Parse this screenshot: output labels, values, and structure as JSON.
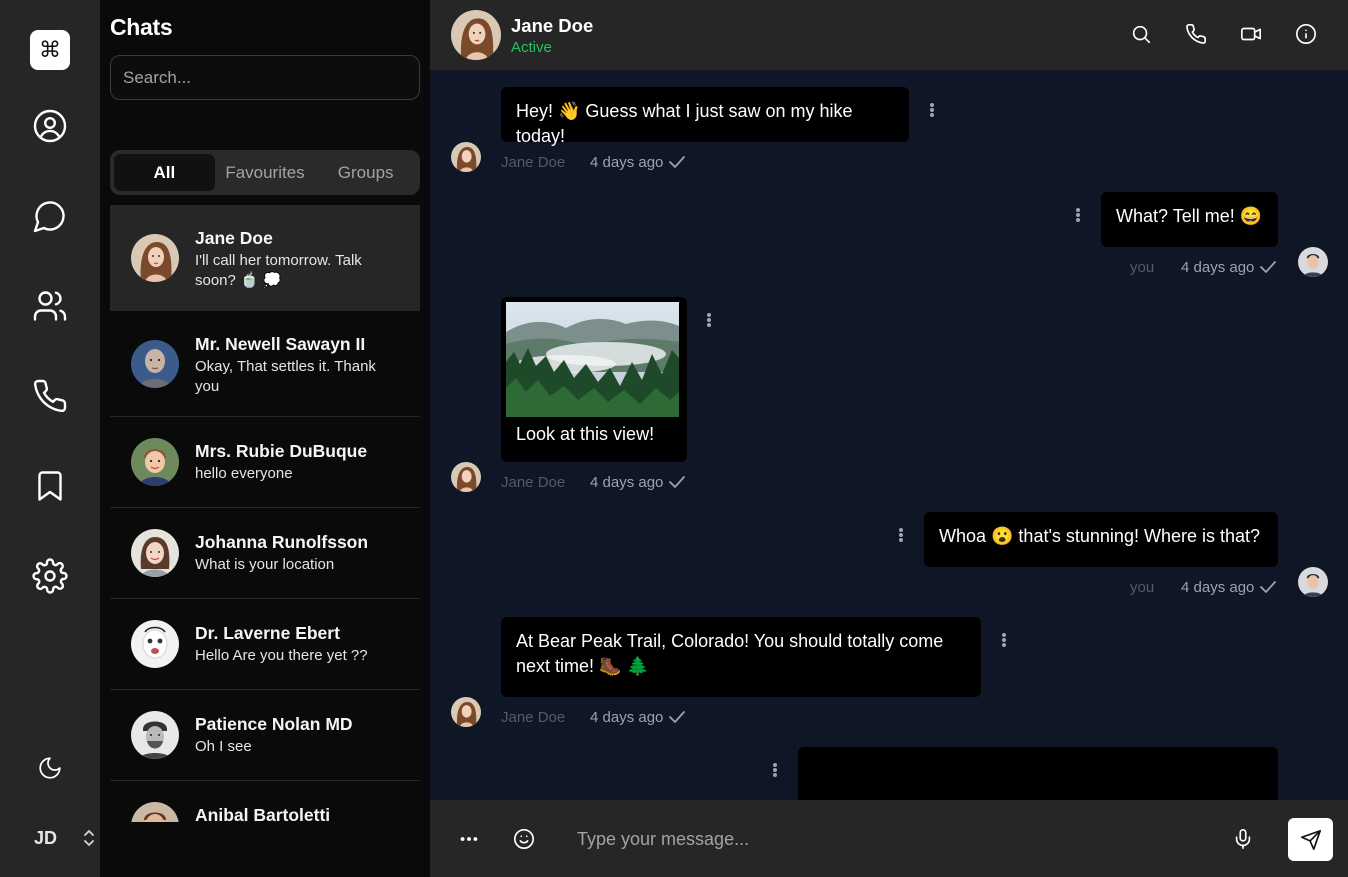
{
  "rail": {
    "logo_glyph": "⌘",
    "icons": [
      "user-circle-icon",
      "chat-bubble-icon",
      "users-icon",
      "phone-icon",
      "bookmark-icon",
      "gear-icon",
      "moon-icon"
    ],
    "user_initials": "JD"
  },
  "sidebar": {
    "title": "Chats",
    "search_placeholder": "Search...",
    "tabs": [
      {
        "label": "All",
        "active": true
      },
      {
        "label": "Favourites",
        "active": false
      },
      {
        "label": "Groups",
        "active": false
      }
    ],
    "chats": [
      {
        "name": "Jane Doe",
        "last_message": "I'll call her tomorrow. Talk soon? 🍵 💭",
        "active": true
      },
      {
        "name": "Mr. Newell Sawayn II",
        "last_message": "Okay, That settles it. Thank you",
        "active": false
      },
      {
        "name": "Mrs. Rubie DuBuque",
        "last_message": "hello everyone",
        "active": false
      },
      {
        "name": "Johanna Runolfsson",
        "last_message": "What is your location",
        "active": false
      },
      {
        "name": "Dr. Laverne Ebert",
        "last_message": "Hello Are you there yet ??",
        "active": false
      },
      {
        "name": "Patience Nolan MD",
        "last_message": "Oh I see",
        "active": false
      },
      {
        "name": "Anibal Bartoletti",
        "last_message": "",
        "active": false
      }
    ]
  },
  "header": {
    "name": "Jane Doe",
    "status": "Active",
    "status_color": "#22c55e",
    "actions": [
      "search-icon",
      "phone-icon",
      "video-icon",
      "info-icon"
    ]
  },
  "messages": [
    {
      "from": "Jane Doe",
      "text": "Hey! 👋 Guess what I just saw on my hike today!",
      "time": "4 days ago",
      "outgoing": false
    },
    {
      "from": "you",
      "text": "What? Tell me! 😄",
      "time": "4 days ago",
      "outgoing": true
    },
    {
      "from": "Jane Doe",
      "text": "Look at this view!",
      "time": "4 days ago",
      "outgoing": false,
      "has_image": true
    },
    {
      "from": "you",
      "text": "Whoa 😮 that's stunning! Where is that?",
      "time": "4 days ago",
      "outgoing": true
    },
    {
      "from": "Jane Doe",
      "text": "At Bear Peak Trail, Colorado! You should totally come next time! 🥾 🌲",
      "time": "4 days ago",
      "outgoing": false
    }
  ],
  "composer": {
    "placeholder": "Type your message...",
    "icons": [
      "more-icon",
      "emoji-icon",
      "microphone-icon",
      "send-icon"
    ]
  },
  "colors": {
    "rail_bg": "#262626",
    "panel_bg": "#0a0a0a",
    "messages_bg": "#0f1626",
    "bubble_bg": "#000000",
    "active_green": "#22c55e"
  }
}
